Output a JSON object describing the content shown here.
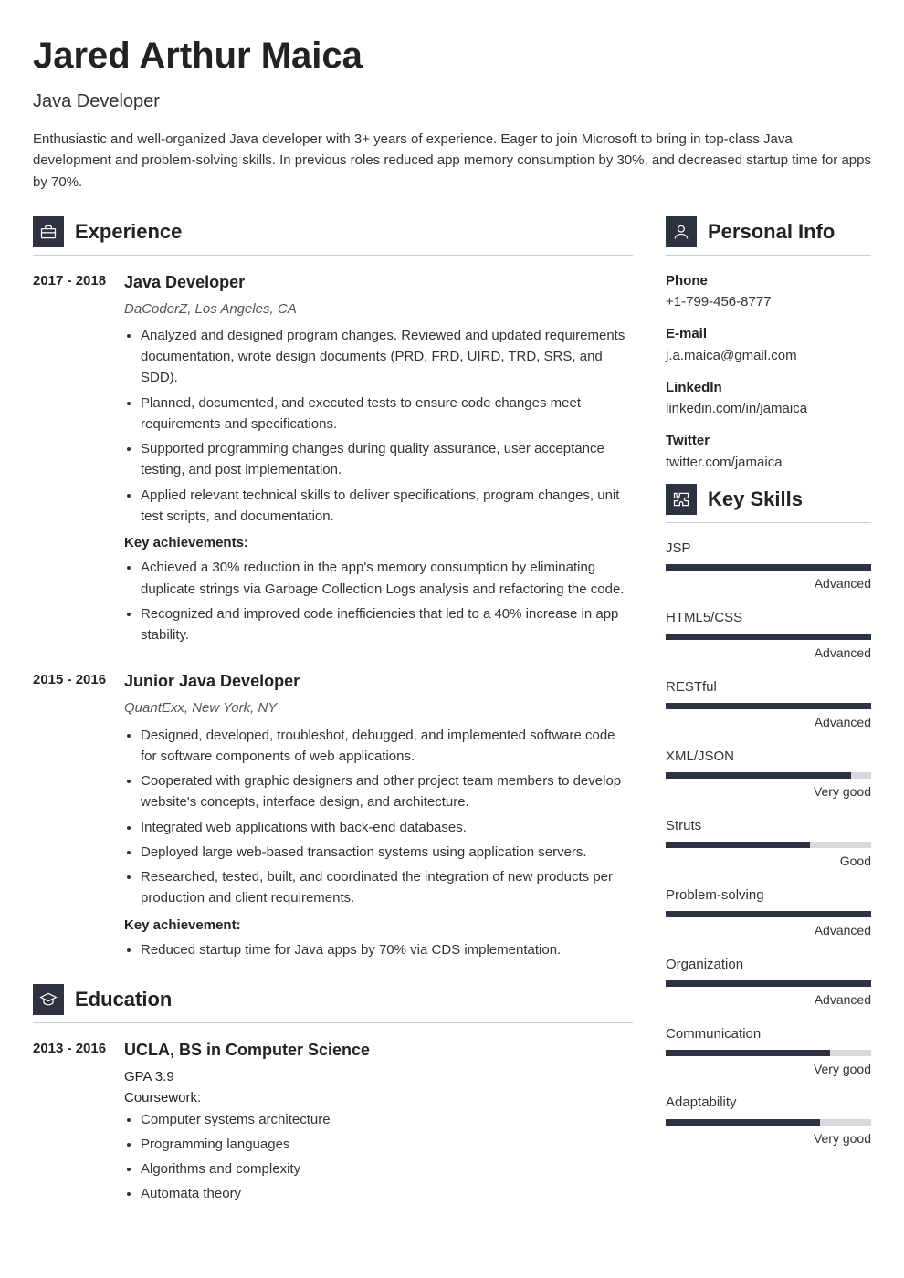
{
  "header": {
    "name": "Jared Arthur Maica",
    "title": "Java Developer",
    "summary": "Enthusiastic and well-organized Java developer with 3+ years of experience. Eager to join Microsoft to bring in top-class Java development and problem-solving skills. In previous roles reduced app memory consumption by 30%, and decreased startup time for apps by 70%."
  },
  "sections": {
    "experience_label": "Experience",
    "education_label": "Education",
    "personal_label": "Personal Info",
    "skills_label": "Key Skills"
  },
  "experience": [
    {
      "dates": "2017 -\n2018",
      "role": "Java Developer",
      "company": "DaCoderZ, Los Angeles, CA",
      "bullets": [
        "Analyzed and designed program changes. Reviewed and updated requirements documentation, wrote design documents (PRD, FRD, UIRD, TRD, SRS, and SDD).",
        "Planned, documented, and executed tests to ensure code changes meet requirements and specifications.",
        "Supported programming changes during quality assurance, user acceptance testing, and post implementation.",
        "Applied relevant technical skills to deliver specifications, program changes, unit test scripts, and documentation."
      ],
      "achievements_label": "Key achievements:",
      "achievements": [
        "Achieved a 30% reduction in the app's memory consumption by eliminating duplicate strings via Garbage Collection Logs analysis and refactoring the code.",
        "Recognized and improved code inefficiencies that led to a 40% increase in app stability."
      ]
    },
    {
      "dates": "2015 -\n2016",
      "role": "Junior Java Developer",
      "company": "QuantExx, New York, NY",
      "bullets": [
        "Designed, developed, troubleshot, debugged, and implemented software code for software components of web applications.",
        "Cooperated with graphic designers and other project team members to develop website's concepts, interface design, and architecture.",
        "Integrated web applications with back-end databases.",
        "Deployed large web-based transaction systems using application servers.",
        "Researched, tested, built, and coordinated the integration of new products per production and client requirements."
      ],
      "achievements_label": "Key achievement:",
      "achievements": [
        "Reduced startup time for Java apps by 70% via CDS implementation."
      ]
    }
  ],
  "education": [
    {
      "dates": "2013 -\n2016",
      "role": "UCLA, BS in Computer Science",
      "gpa": "GPA 3.9",
      "coursework_label": "Coursework:",
      "bullets": [
        "Computer systems architecture",
        "Programming languages",
        "Algorithms and complexity",
        "Automata theory"
      ]
    }
  ],
  "personal": [
    {
      "label": "Phone",
      "value": "+1-799-456-8777"
    },
    {
      "label": "E-mail",
      "value": "j.a.maica@gmail.com"
    },
    {
      "label": "LinkedIn",
      "value": "linkedin.com/in/jamaica"
    },
    {
      "label": "Twitter",
      "value": "twitter.com/jamaica"
    }
  ],
  "skills": [
    {
      "name": "JSP",
      "level": "Advanced",
      "pct": 100
    },
    {
      "name": "HTML5/CSS",
      "level": "Advanced",
      "pct": 100
    },
    {
      "name": "RESTful",
      "level": "Advanced",
      "pct": 100
    },
    {
      "name": "XML/JSON",
      "level": "Very good",
      "pct": 90
    },
    {
      "name": "Struts",
      "level": "Good",
      "pct": 70
    },
    {
      "name": "Problem-solving",
      "level": "Advanced",
      "pct": 100
    },
    {
      "name": "Organization",
      "level": "Advanced",
      "pct": 100
    },
    {
      "name": "Communication",
      "level": "Very good",
      "pct": 80
    },
    {
      "name": "Adaptability",
      "level": "Very good",
      "pct": 75
    }
  ]
}
